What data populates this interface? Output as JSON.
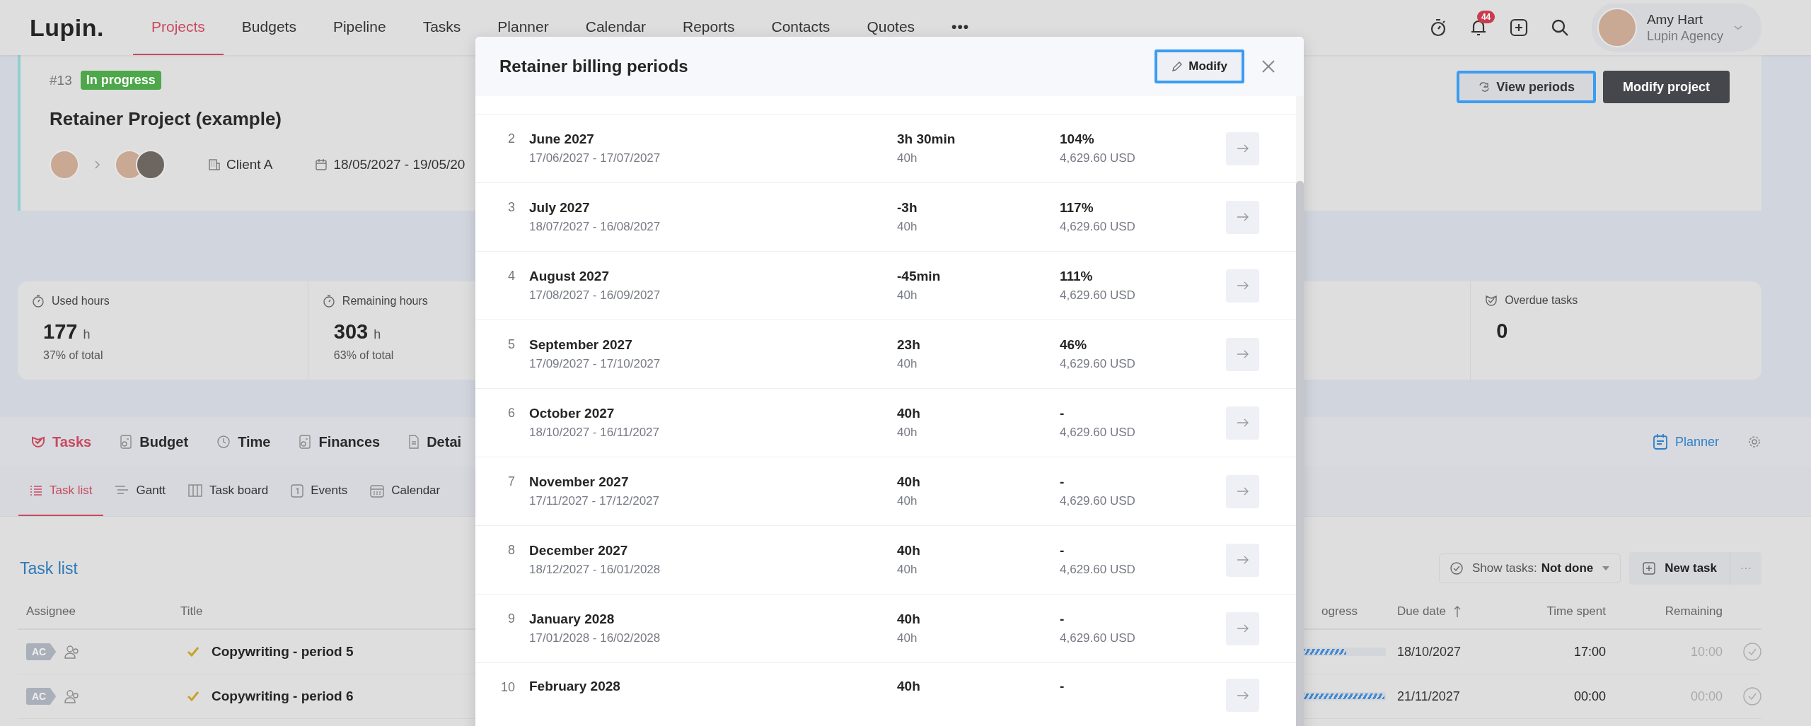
{
  "nav": {
    "logo": "Lupin.",
    "items": [
      {
        "label": "Projects",
        "selected": true
      },
      {
        "label": "Budgets",
        "selected": false
      },
      {
        "label": "Pipeline",
        "selected": false
      },
      {
        "label": "Tasks",
        "selected": false
      },
      {
        "label": "Planner",
        "selected": false
      },
      {
        "label": "Calendar",
        "selected": false
      },
      {
        "label": "Reports",
        "selected": false
      },
      {
        "label": "Contacts",
        "selected": false
      },
      {
        "label": "Quotes",
        "selected": false
      }
    ],
    "more": "•••",
    "notifications": "44",
    "user": {
      "name": "Amy Hart",
      "org": "Lupin Agency"
    }
  },
  "project": {
    "number": "#13",
    "status": "In progress",
    "title": "Retainer Project (example)",
    "client": "Client A",
    "dates": "18/05/2027 - 19/05/20",
    "buttons": [
      {
        "label": "View periods",
        "kind": "secondary",
        "highlighted": true
      },
      {
        "label": "Modify project",
        "kind": "primary",
        "highlighted": false
      }
    ]
  },
  "stats_left": [
    {
      "kind": "time",
      "label": "Used hours",
      "value": "177",
      "unit": "h",
      "note": "37% of total"
    },
    {
      "kind": "time",
      "label": "Remaining hours",
      "value": "303",
      "unit": "h",
      "note": "63% of total"
    }
  ],
  "stats_right": [
    {
      "kind": "tasks",
      "label": "Overdue tasks",
      "value": "0"
    }
  ],
  "tabs": [
    {
      "label": "Tasks",
      "selected": true
    },
    {
      "label": "Budget",
      "selected": false
    },
    {
      "label": "Time",
      "selected": false
    },
    {
      "label": "Finances",
      "selected": false
    },
    {
      "label": "Detai",
      "selected": false
    }
  ],
  "planner": "Planner",
  "subtabs": [
    {
      "label": "Task list",
      "selected": true
    },
    {
      "label": "Gantt",
      "selected": false
    },
    {
      "label": "Task board",
      "selected": false
    },
    {
      "label": "Events",
      "selected": false
    },
    {
      "label": "Calendar",
      "selected": false
    }
  ],
  "task_list": {
    "title": "Task list",
    "filter_label": "Show tasks:",
    "filter_value": "Not done",
    "new_task": "New task",
    "more": "···",
    "columns": [
      "Assignee",
      "Title",
      "ogress",
      "Due date",
      "Time spent",
      "Remaining"
    ],
    "rows": [
      {
        "assignee": "AC",
        "title": "Copywriting - period 5",
        "level": 0.6,
        "due": "18/10/2027",
        "spent": "17:00",
        "remaining": "10:00"
      },
      {
        "assignee": "AC",
        "title": "Copywriting - period 6",
        "level": 1,
        "due": "21/11/2027",
        "spent": "00:00",
        "remaining": "00:00"
      }
    ]
  },
  "modal": {
    "title": "Retainer billing periods",
    "modify": {
      "label": "Modify",
      "highlighted": true
    },
    "periods": [
      {
        "n": "2",
        "name": "June 2027",
        "dates": "17/06/2027 - 17/07/2027",
        "hours": "3h 30min",
        "budget": "40h",
        "percent": "104%",
        "amount": "4,629.60 USD"
      },
      {
        "n": "3",
        "name": "July 2027",
        "dates": "18/07/2027 - 16/08/2027",
        "hours": "-3h",
        "budget": "40h",
        "percent": "117%",
        "amount": "4,629.60 USD"
      },
      {
        "n": "4",
        "name": "August 2027",
        "dates": "17/08/2027 - 16/09/2027",
        "hours": "-45min",
        "budget": "40h",
        "percent": "111%",
        "amount": "4,629.60 USD"
      },
      {
        "n": "5",
        "name": "September 2027",
        "dates": "17/09/2027 - 17/10/2027",
        "hours": "23h",
        "budget": "40h",
        "percent": "46%",
        "amount": "4,629.60 USD"
      },
      {
        "n": "6",
        "name": "October 2027",
        "dates": "18/10/2027 - 16/11/2027",
        "hours": "40h",
        "budget": "40h",
        "percent": "-",
        "amount": "4,629.60 USD"
      },
      {
        "n": "7",
        "name": "November 2027",
        "dates": "17/11/2027 - 17/12/2027",
        "hours": "40h",
        "budget": "40h",
        "percent": "-",
        "amount": "4,629.60 USD"
      },
      {
        "n": "8",
        "name": "December 2027",
        "dates": "18/12/2027 - 16/01/2028",
        "hours": "40h",
        "budget": "40h",
        "percent": "-",
        "amount": "4,629.60 USD"
      },
      {
        "n": "9",
        "name": "January 2028",
        "dates": "17/01/2028 - 16/02/2028",
        "hours": "40h",
        "budget": "40h",
        "percent": "-",
        "amount": "4,629.60 USD"
      },
      {
        "n": "10",
        "name": "February 2028",
        "hours": "40h",
        "percent": "-"
      }
    ]
  }
}
